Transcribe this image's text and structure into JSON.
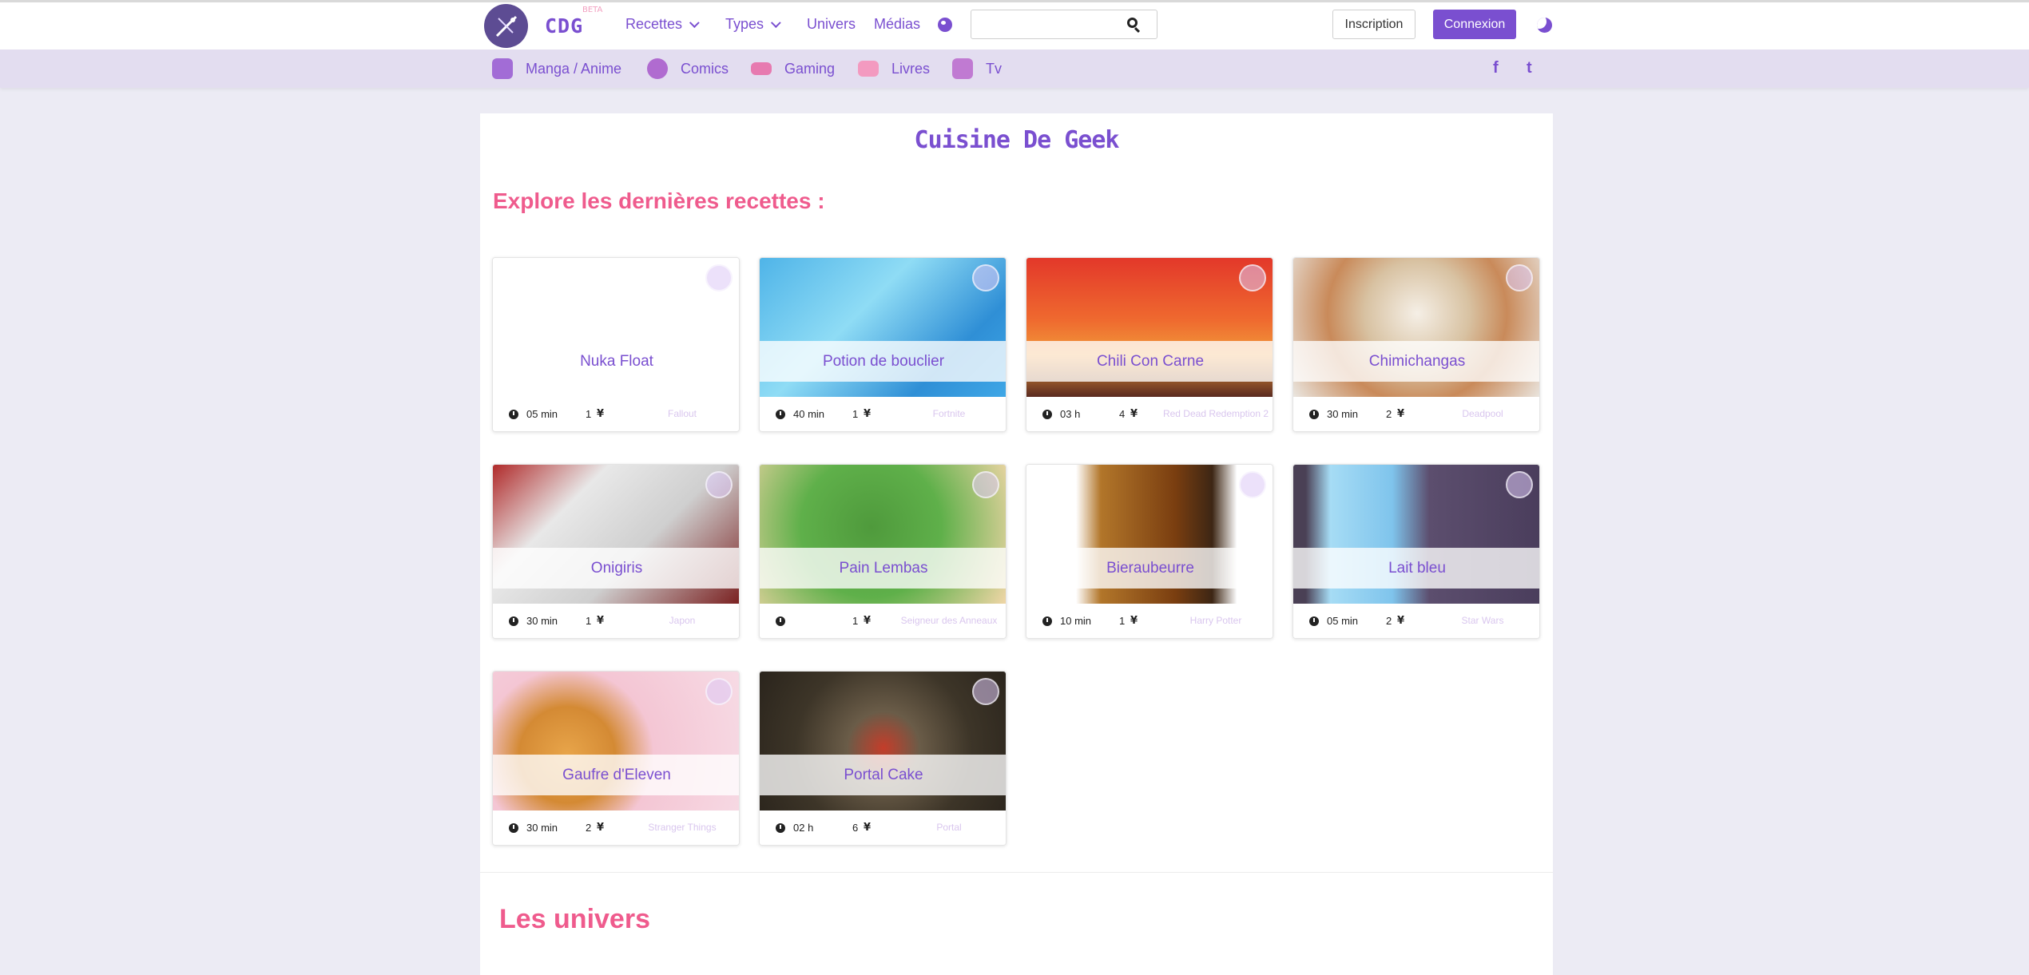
{
  "brand": {
    "name": "CDG",
    "badge": "BETA"
  },
  "nav": {
    "items": [
      {
        "label": "Recettes",
        "dropdown": true
      },
      {
        "label": "Types",
        "dropdown": true
      },
      {
        "label": "Univers",
        "dropdown": false
      },
      {
        "label": "Médias",
        "dropdown": false
      }
    ],
    "search_placeholder": "",
    "signup_label": "Inscription",
    "login_label": "Connexion"
  },
  "categories": [
    {
      "label": "Manga / Anime",
      "icon": "cat-face-icon",
      "color": "#a26cd6"
    },
    {
      "label": "Comics",
      "icon": "star-badge-icon",
      "color": "#b06bd0"
    },
    {
      "label": "Gaming",
      "icon": "gamepad-icon",
      "color": "#e77ab0"
    },
    {
      "label": "Livres",
      "icon": "book-icon",
      "color": "#f39ac0"
    },
    {
      "label": "Tv",
      "icon": "tv-icon",
      "color": "#c07ad2"
    }
  ],
  "social": {
    "facebook": "f",
    "twitter": "t"
  },
  "page": {
    "title": "Cuisine De Geek",
    "recent_heading": "Explore les dernières recettes :",
    "universes_heading": "Les univers"
  },
  "recipes": [
    {
      "title": "Nuka Float",
      "time": "05 min",
      "servings": "1",
      "universe": "Fallout"
    },
    {
      "title": "Potion de bouclier",
      "time": "40 min",
      "servings": "1",
      "universe": "Fortnite"
    },
    {
      "title": "Chili Con Carne",
      "time": "03 h",
      "servings": "4",
      "universe": "Red Dead Redemption 2"
    },
    {
      "title": "Chimichangas",
      "time": "30 min",
      "servings": "2",
      "universe": "Deadpool"
    },
    {
      "title": "Onigiris",
      "time": "30 min",
      "servings": "1",
      "universe": "Japon"
    },
    {
      "title": "Pain Lembas",
      "time": "",
      "servings": "1",
      "universe": "Seigneur des Anneaux"
    },
    {
      "title": "Bieraubeurre",
      "time": "10 min",
      "servings": "1",
      "universe": "Harry Potter"
    },
    {
      "title": "Lait bleu",
      "time": "05 min",
      "servings": "2",
      "universe": "Star Wars"
    },
    {
      "title": "Gaufre d'Eleven",
      "time": "30 min",
      "servings": "2",
      "universe": "Stranger Things"
    },
    {
      "title": "Portal Cake",
      "time": "02 h",
      "servings": "6",
      "universe": "Portal"
    }
  ],
  "colors": {
    "accent": "#7a4fd0",
    "heading": "#ef5b8d",
    "background": "#ecebf4"
  }
}
